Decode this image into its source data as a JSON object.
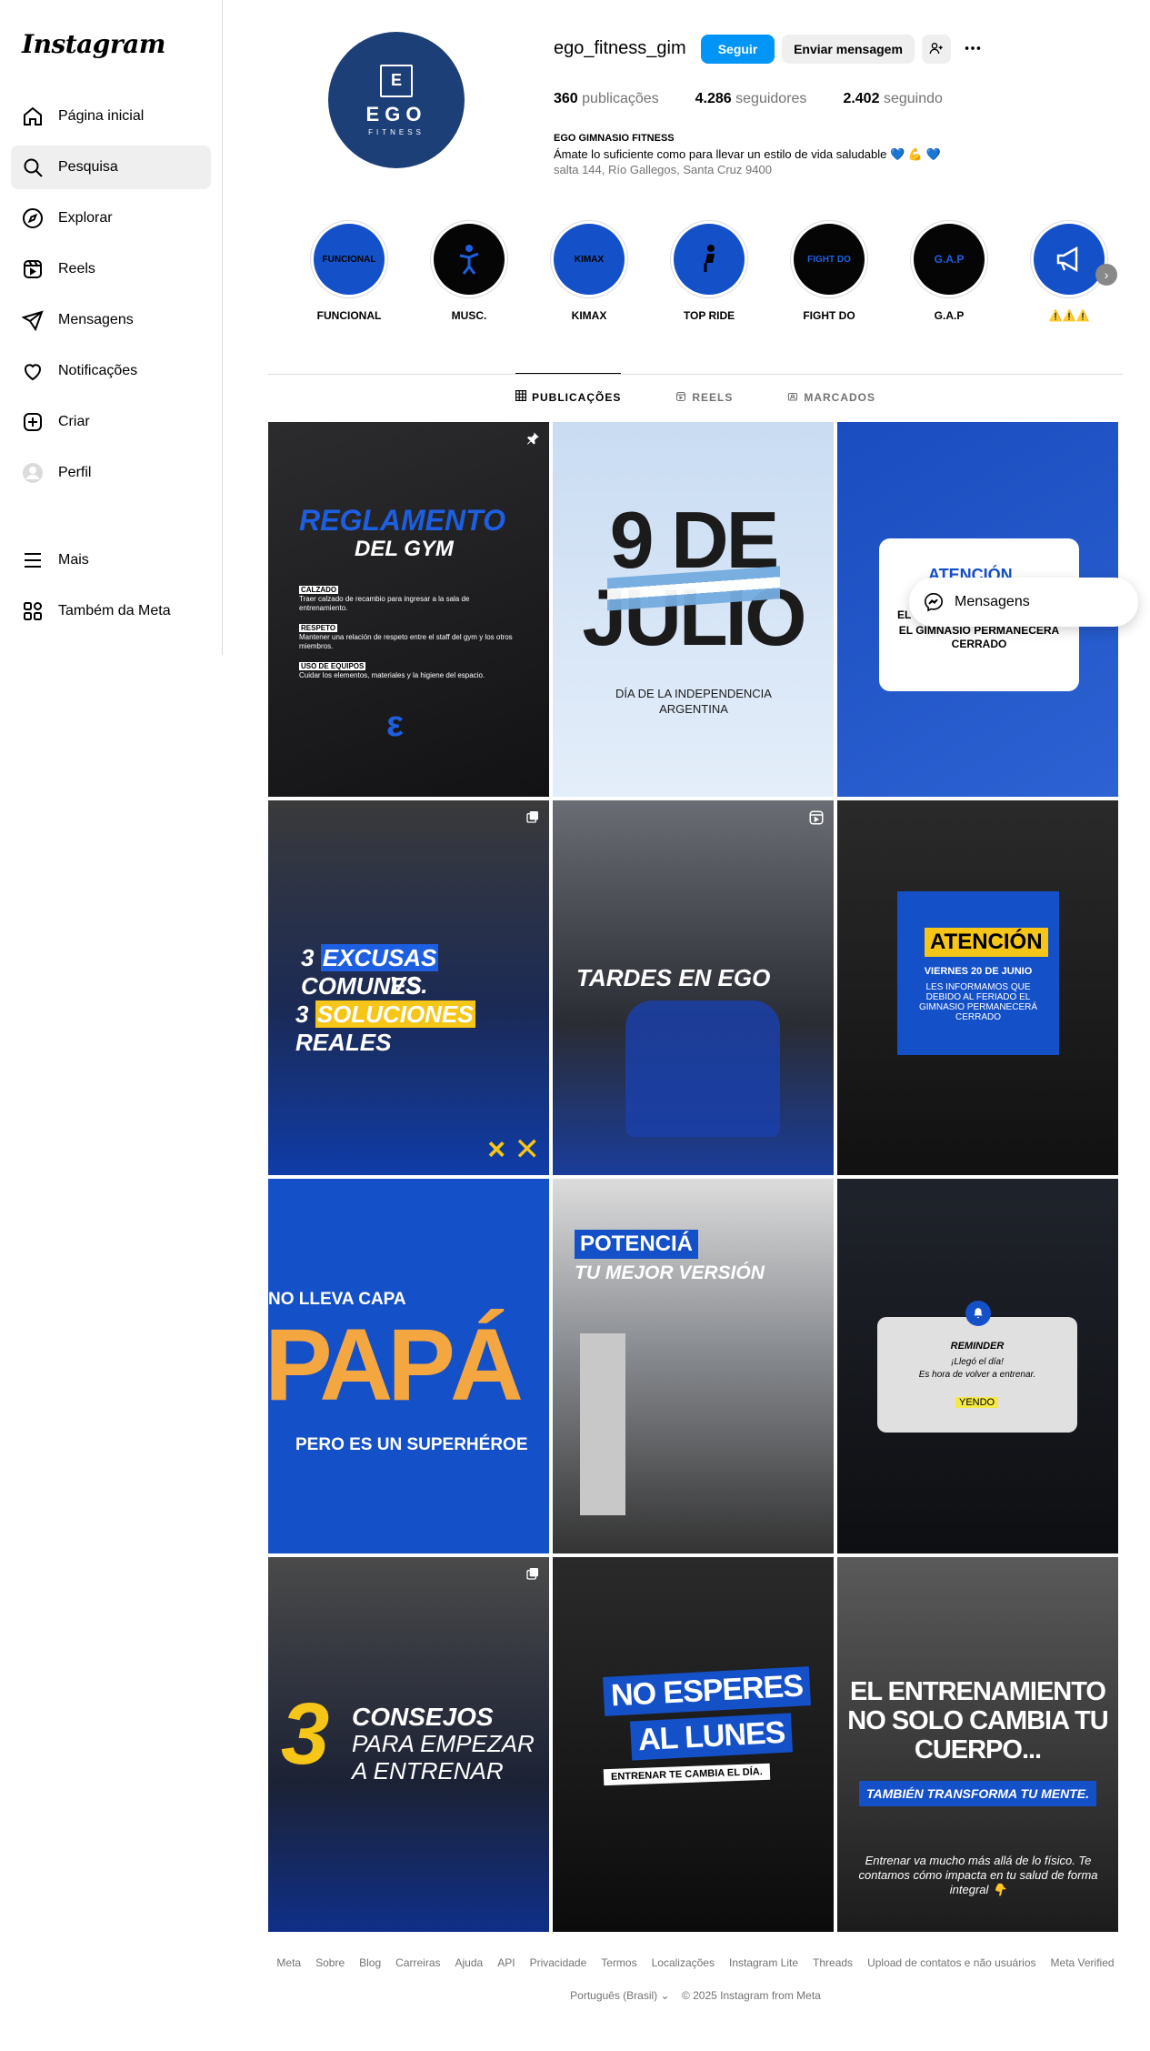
{
  "brand": "Instagram",
  "nav": {
    "items": [
      {
        "label": "Página inicial"
      },
      {
        "label": "Pesquisa"
      },
      {
        "label": "Explorar"
      },
      {
        "label": "Reels"
      },
      {
        "label": "Mensagens"
      },
      {
        "label": "Notificações"
      },
      {
        "label": "Criar"
      },
      {
        "label": "Perfil"
      }
    ],
    "more": "Mais",
    "meta": "Também da Meta"
  },
  "profile": {
    "username": "ego_fitness_gim",
    "avatar_brand": "EGO",
    "avatar_sub": "FITNESS",
    "follow_label": "Seguir",
    "message_label": "Enviar mensagem",
    "stats": [
      {
        "value": "360",
        "label": "publicações"
      },
      {
        "value": "4.286",
        "label": "seguidores"
      },
      {
        "value": "2.402",
        "label": "seguindo"
      }
    ],
    "name": "EGO GIMNASIO FITNESS",
    "bio": "Ámate lo suficiente como para llevar un estilo de vida saludable 💙 💪 💙",
    "location": "salta 144, Río Gallegos, Santa Cruz 9400"
  },
  "highlights": [
    {
      "label": "FUNCIONAL",
      "inner": "FUNCIONAL",
      "bg": "#1450c8"
    },
    {
      "label": "MUSC.",
      "inner": "",
      "bg": "#050505"
    },
    {
      "label": "KIMAX",
      "inner": "KIMAX",
      "bg": "#1450c8"
    },
    {
      "label": "TOP RIDE",
      "inner": "",
      "bg": "#1450c8"
    },
    {
      "label": "FIGHT DO",
      "inner": "FIGHT DO",
      "bg": "#050505"
    },
    {
      "label": "G.A.P",
      "inner": "G.A.P",
      "bg": "#050505"
    },
    {
      "label": "⚠️⚠️⚠️",
      "inner": "",
      "bg": "#1450c8"
    }
  ],
  "tabs": [
    {
      "label": "PUBLICAÇÕES"
    },
    {
      "label": "REELS"
    },
    {
      "label": "MARCADOS"
    }
  ],
  "posts": {
    "p1": {
      "t1": "REGLAMENTO",
      "t2": "DEL GYM",
      "r1t": "CALZADO",
      "r1": "Traer calzado de recambio para ingresar a la sala de entrenamiento.",
      "r2t": "RESPETO",
      "r2": "Mantener una relación de respeto entre el staff del gym y los otros miembros.",
      "r3t": "USO DE EQUIPOS",
      "r3": "Cuidar los elementos, materiales y la higiene del espacio."
    },
    "p2": {
      "t1": "9 DE",
      "t2": "JULIO",
      "sub": "DÍA DE LA INDEPENDENCIA ARGENTINA"
    },
    "p3": {
      "t1": "ATENCIÓN",
      "t2": "EL GIMNASIO PERMANECERÁ CERRADO",
      "t0": "EL"
    },
    "p4": {
      "t1": "3",
      "t2": "EXCUSAS",
      "t3": "COMUNES",
      "t4": "VS.",
      "t5": "3",
      "t6": "SOLUCIONES",
      "t7": "REALES"
    },
    "p5": {
      "t1": "TARDES EN EGO"
    },
    "p6": {
      "t1": "ATENCIÓN",
      "t2": "VIERNES 20 DE JUNIO",
      "t3": "LES INFORMAMOS QUE DEBIDO AL FERIADO EL GIMNASIO PERMANECERÁ CERRADO"
    },
    "p7": {
      "t1": "NO LLEVA CAPA",
      "t2": "PAPÁ",
      "t3": "PERO ES UN SUPERHÉROE"
    },
    "p8": {
      "t1": "POTENCIÁ",
      "t2": "TU MEJOR VERSIÓN"
    },
    "p9": {
      "t1": "REMINDER",
      "t2": "¡Llegó el día!",
      "t3": "Es hora de volver a entrenar.",
      "t4": "YENDO"
    },
    "p10": {
      "t1": "3",
      "t2": "CONSEJOS",
      "t3": "PARA EMPEZAR",
      "t4": "A ENTRENAR"
    },
    "p11": {
      "t1": "NO ESPERES",
      "t2": "AL LUNES",
      "t3": "ENTRENAR TE CAMBIA EL DÍA."
    },
    "p12": {
      "t1": "EL ENTRENAMIENTO",
      "t2": "NO SOLO CAMBIA TU",
      "t3": "CUERPO...",
      "t4": "TAMBIÉN TRANSFORMA TU MENTE.",
      "t5": "Entrenar va mucho más allá de lo físico. Te contamos cómo impacta en tu salud de forma integral 👇"
    }
  },
  "messages_popup": "Mensagens",
  "footer": {
    "links": [
      "Meta",
      "Sobre",
      "Blog",
      "Carreiras",
      "Ajuda",
      "API",
      "Privacidade",
      "Termos",
      "Localizações",
      "Instagram Lite",
      "Threads",
      "Upload de contatos e não usuários",
      "Meta Verified"
    ],
    "language": "Português (Brasil)",
    "copyright": "© 2025 Instagram from Meta"
  },
  "colors": {
    "accent": "#0095f6",
    "brand_blue": "#1450c8",
    "yellow": "#f5c518"
  },
  "icons": [
    "home-icon",
    "search-icon",
    "explore-icon",
    "reels-icon",
    "messages-icon",
    "heart-icon",
    "create-icon",
    "profile-icon",
    "menu-icon",
    "meta-icon"
  ]
}
